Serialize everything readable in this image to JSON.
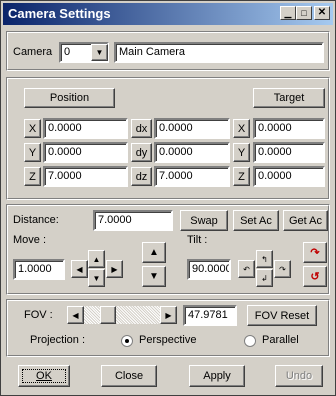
{
  "window": {
    "title": "Camera Settings"
  },
  "camera": {
    "label": "Camera",
    "index": "0",
    "name": "Main Camera"
  },
  "axes": {
    "position_label": "Position",
    "target_label": "Target",
    "rows": [
      {
        "axis": "X",
        "pos": "0.0000",
        "dlabel": "dx",
        "delta": "0.0000",
        "taxis": "X",
        "target": "0.0000"
      },
      {
        "axis": "Y",
        "pos": "0.0000",
        "dlabel": "dy",
        "delta": "0.0000",
        "taxis": "Y",
        "target": "0.0000"
      },
      {
        "axis": "Z",
        "pos": "7.0000",
        "dlabel": "dz",
        "delta": "7.0000",
        "taxis": "Z",
        "target": "0.0000"
      }
    ]
  },
  "distance": {
    "label": "Distance:",
    "value": "7.0000",
    "swap": "Swap",
    "set_ac": "Set Ac",
    "get_ac": "Get Ac"
  },
  "move": {
    "label": "Move :",
    "value": "1.0000"
  },
  "tilt": {
    "label": "Tilt :",
    "value": "90.0000"
  },
  "fov": {
    "label": "FOV :",
    "value": "47.9781",
    "reset": "FOV Reset",
    "slider_fraction": 0.27
  },
  "projection": {
    "label": "Projection :",
    "perspective": "Perspective",
    "parallel": "Parallel",
    "selected": "Perspective"
  },
  "buttons": {
    "ok": "OK",
    "close": "Close",
    "apply": "Apply",
    "undo": "Undo"
  }
}
